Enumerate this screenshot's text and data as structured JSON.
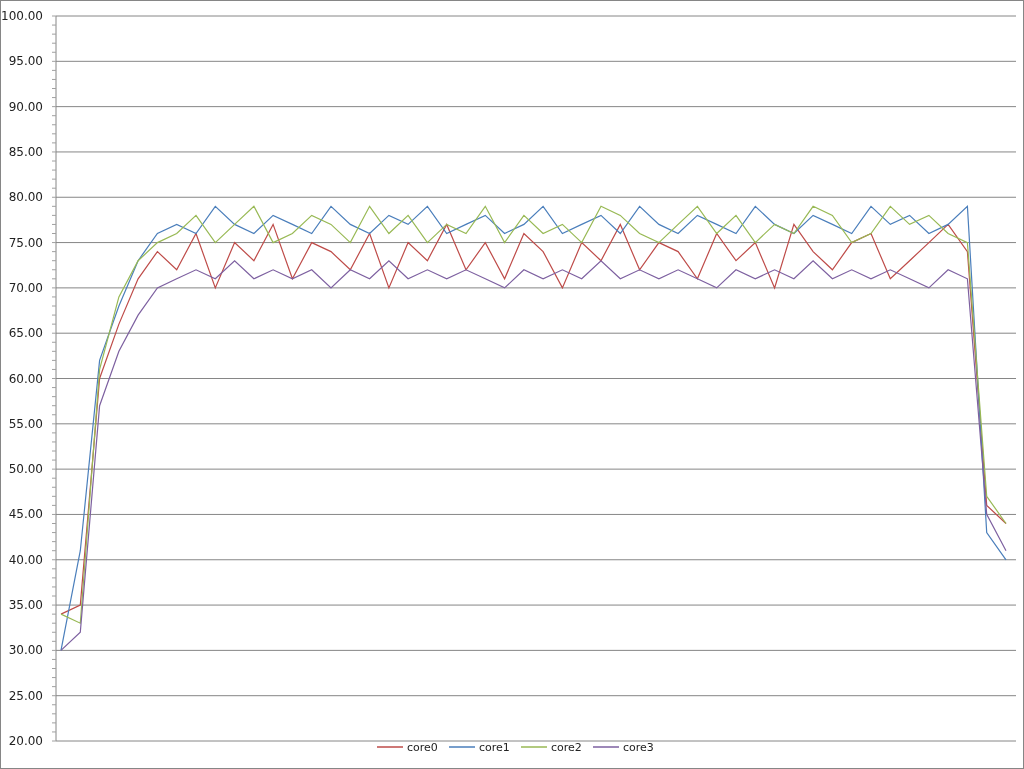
{
  "chart": {
    "chart_data": {
      "type": "line",
      "grid": true,
      "legend": true,
      "ylim": [
        20,
        100
      ],
      "yticks": [
        {
          "value": 20,
          "label": "20.00"
        },
        {
          "value": 25,
          "label": "25.00"
        },
        {
          "value": 30,
          "label": "30.00"
        },
        {
          "value": 35,
          "label": "35.00"
        },
        {
          "value": 40,
          "label": "40.00"
        },
        {
          "value": 45,
          "label": "45.00"
        },
        {
          "value": 50,
          "label": "50.00"
        },
        {
          "value": 55,
          "label": "55.00"
        },
        {
          "value": 60,
          "label": "60.00"
        },
        {
          "value": 65,
          "label": "65.00"
        },
        {
          "value": 70,
          "label": "70.00"
        },
        {
          "value": 75,
          "label": "75.00"
        },
        {
          "value": 80,
          "label": "80.00"
        },
        {
          "value": 85,
          "label": "85.00"
        },
        {
          "value": 90,
          "label": "90.00"
        },
        {
          "value": 95,
          "label": "95.00"
        },
        {
          "value": 100,
          "label": "100.00"
        }
      ],
      "series": [
        {
          "name": "core0",
          "color": "#be4b48",
          "values": [
            34,
            35,
            60,
            66,
            71,
            74,
            72,
            76,
            70,
            75,
            73,
            77,
            71,
            75,
            74,
            72,
            76,
            70,
            75,
            73,
            77,
            72,
            75,
            71,
            76,
            74,
            70,
            75,
            73,
            77,
            72,
            75,
            74,
            71,
            76,
            73,
            75,
            70,
            77,
            74,
            72,
            75,
            76,
            71,
            73,
            75,
            77,
            74,
            46,
            44
          ]
        },
        {
          "name": "core1",
          "color": "#4a7ebb",
          "values": [
            30,
            41,
            62,
            68,
            73,
            76,
            77,
            76,
            79,
            77,
            76,
            78,
            77,
            76,
            79,
            77,
            76,
            78,
            77,
            79,
            76,
            77,
            78,
            76,
            77,
            79,
            76,
            77,
            78,
            76,
            79,
            77,
            76,
            78,
            77,
            76,
            79,
            77,
            76,
            78,
            77,
            76,
            79,
            77,
            78,
            76,
            77,
            79,
            43,
            40
          ]
        },
        {
          "name": "core2",
          "color": "#98b954",
          "values": [
            34,
            33,
            61,
            69,
            73,
            75,
            76,
            78,
            75,
            77,
            79,
            75,
            76,
            78,
            77,
            75,
            79,
            76,
            78,
            75,
            77,
            76,
            79,
            75,
            78,
            76,
            77,
            75,
            79,
            78,
            76,
            75,
            77,
            79,
            76,
            78,
            75,
            77,
            76,
            79,
            78,
            75,
            76,
            79,
            77,
            78,
            76,
            75,
            47,
            44
          ]
        },
        {
          "name": "core3",
          "color": "#7d60a0",
          "values": [
            30,
            32,
            57,
            63,
            67,
            70,
            71,
            72,
            71,
            73,
            71,
            72,
            71,
            72,
            70,
            72,
            71,
            73,
            71,
            72,
            71,
            72,
            71,
            70,
            72,
            71,
            72,
            71,
            73,
            71,
            72,
            71,
            72,
            71,
            70,
            72,
            71,
            72,
            71,
            73,
            71,
            72,
            71,
            72,
            71,
            70,
            72,
            71,
            45,
            41
          ]
        }
      ]
    }
  }
}
